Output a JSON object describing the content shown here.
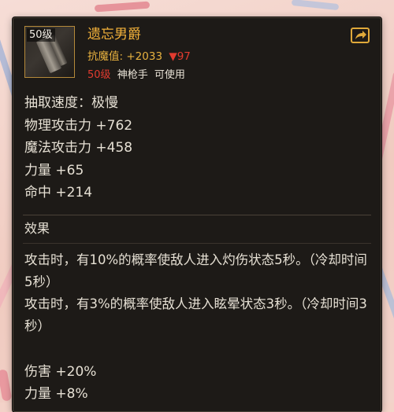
{
  "item": {
    "level_tag": "50级",
    "name": "遗忘男爵",
    "resist_label": "抗魔值:",
    "resist_value": "+2033",
    "resist_diff": "▼97",
    "req_level": "50级",
    "req_class": "神枪手",
    "req_usable": "可使用"
  },
  "stats": [
    "抽取速度：极慢",
    "物理攻击力 +762",
    "魔法攻击力 +458",
    "力量 +65",
    "命中 +214"
  ],
  "effects": {
    "title": "效果",
    "lines": [
      "攻击时，有10%的概率使敌人进入灼伤状态5秒。（冷却时间5秒）",
      "攻击时，有3%的概率使敌人进入眩晕状态3秒。（冷却时间3秒）"
    ],
    "bonuses": [
      "伤害 +20%",
      "力量 +8%"
    ]
  },
  "colors": {
    "title": "#f2b13a",
    "decrease": "#e23b2f",
    "panel_bg": "#1d1a17"
  },
  "icons": {
    "item": "weapon-icon",
    "share": "share-icon"
  }
}
